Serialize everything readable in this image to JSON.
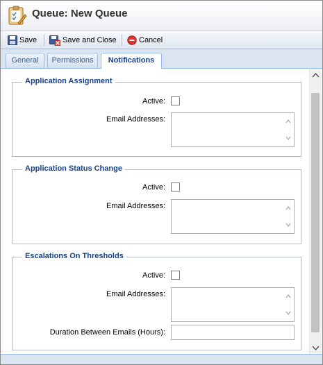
{
  "window": {
    "title": "Queue: New Queue",
    "icon": "clipboard-edit-icon"
  },
  "toolbar": {
    "save_label": "Save",
    "save_close_label": "Save and Close",
    "cancel_label": "Cancel"
  },
  "tabs": [
    {
      "label": "General",
      "active": false
    },
    {
      "label": "Permissions",
      "active": false
    },
    {
      "label": "Notifications",
      "active": true
    }
  ],
  "sections": [
    {
      "title": "Application Assignment",
      "active_label": "Active:",
      "active_checked": false,
      "email_label": "Email Addresses:",
      "email_value": ""
    },
    {
      "title": "Application Status Change",
      "active_label": "Active:",
      "active_checked": false,
      "email_label": "Email Addresses:",
      "email_value": ""
    },
    {
      "title": "Escalations On Thresholds",
      "active_label": "Active:",
      "active_checked": false,
      "email_label": "Email Addresses:",
      "email_value": "",
      "duration_label": "Duration Between Emails (Hours):",
      "duration_value": ""
    }
  ],
  "colors": {
    "legend": "#15428b",
    "tab_active_text": "#15428b",
    "cancel_icon": "#e03030"
  }
}
